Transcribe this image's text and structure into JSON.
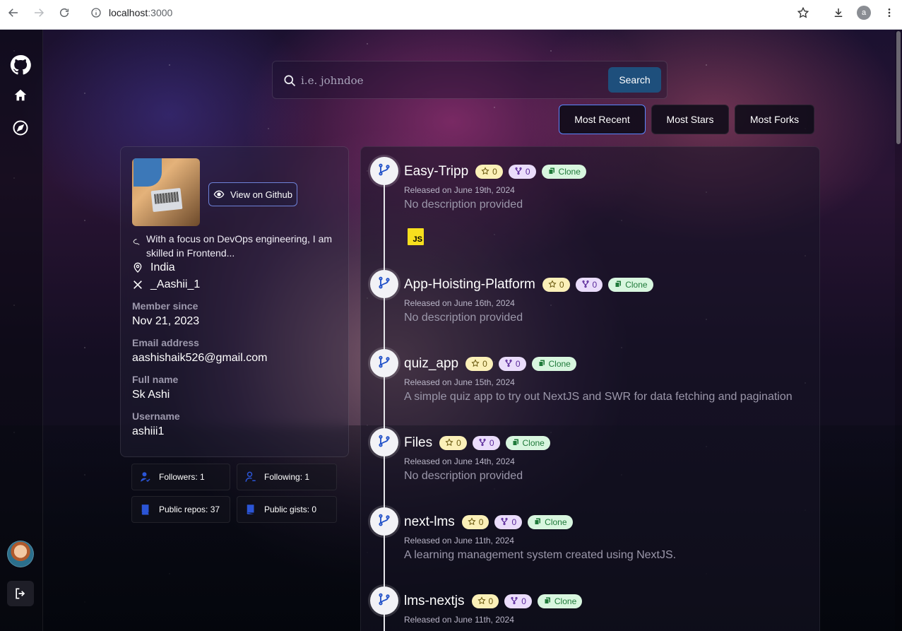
{
  "browser": {
    "url_host": "localhost",
    "url_port": ":3000",
    "profile_initial": "a"
  },
  "search": {
    "placeholder": "i.e. johndoe",
    "button_label": "Search"
  },
  "sort": {
    "most_recent": "Most Recent",
    "most_stars": "Most Stars",
    "most_forks": "Most Forks"
  },
  "profile": {
    "view_github_label": "View on Github",
    "bio": "With a focus on DevOps engineering, I am skilled in Frontend...",
    "location": "India",
    "twitter": "_Aashii_1",
    "member_since_label": "Member since",
    "member_since": "Nov 21, 2023",
    "email_label": "Email address",
    "email": "aashishaik526@gmail.com",
    "full_name_label": "Full name",
    "full_name": "Sk Ashi",
    "username_label": "Username",
    "username": "ashiii1"
  },
  "stats": {
    "followers": "Followers: 1",
    "following": "Following: 1",
    "public_repos": "Public repos: 37",
    "public_gists": "Public gists: 0"
  },
  "repos": [
    {
      "name": "Easy-Tripp",
      "stars": "0",
      "forks": "0",
      "clone_label": "Clone",
      "released": "Released on June 19th, 2024",
      "description": "No description provided",
      "language_badge": "JS"
    },
    {
      "name": "App-Hoisting-Platform",
      "stars": "0",
      "forks": "0",
      "clone_label": "Clone",
      "released": "Released on June 16th, 2024",
      "description": "No description provided"
    },
    {
      "name": "quiz_app",
      "stars": "0",
      "forks": "0",
      "clone_label": "Clone",
      "released": "Released on June 15th, 2024",
      "description": "A simple quiz app to try out NextJS and SWR for data fetching and pagination"
    },
    {
      "name": "Files",
      "stars": "0",
      "forks": "0",
      "clone_label": "Clone",
      "released": "Released on June 14th, 2024",
      "description": "No description provided"
    },
    {
      "name": "next-lms",
      "stars": "0",
      "forks": "0",
      "clone_label": "Clone",
      "released": "Released on June 11th, 2024",
      "description": "A learning management system created using NextJS."
    },
    {
      "name": "lms-nextjs",
      "stars": "0",
      "forks": "0",
      "clone_label": "Clone",
      "released": "Released on June 11th, 2024",
      "description": ""
    }
  ],
  "colors": {
    "search_button": "#1e4f7c",
    "active_sort_border": "#5a86ff",
    "star_badge": "#fbf0b8",
    "fork_badge": "#eadcfb",
    "clone_badge": "#d8f6df",
    "js_badge": "#f7df1e"
  }
}
